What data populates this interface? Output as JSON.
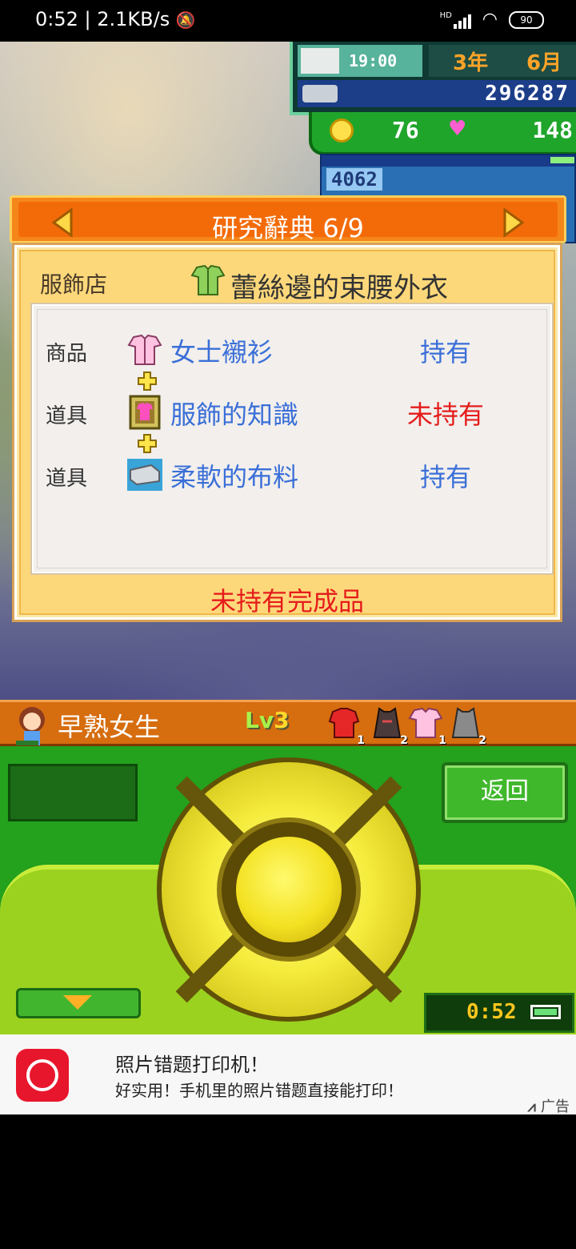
{
  "status_bar": {
    "time": "0:52",
    "net_speed": "2.1KB/s",
    "network_type": "HD",
    "battery": "90"
  },
  "hud": {
    "clock_time": "19:00",
    "year_label": "3年",
    "month_label": "6月",
    "money": "296287",
    "research_points": "76",
    "hearts": "148",
    "shop_customers": "4062"
  },
  "dictionary": {
    "title": "研究辭典 6/9",
    "shop_name": "服飾店",
    "product_name": "蕾絲邊的束腰外衣",
    "rows": [
      {
        "label": "商品",
        "name": "女士襯衫",
        "status": "持有"
      },
      {
        "label": "道具",
        "name": "服飾的知識",
        "status": "未持有"
      },
      {
        "label": "道具",
        "name": "柔軟的布料",
        "status": "持有"
      }
    ],
    "completion_status": "未持有完成品"
  },
  "character": {
    "name": "早熟女生",
    "level_prefix": "Lv",
    "level": "3",
    "equipment_counts": [
      "1",
      "2",
      "1",
      "2"
    ]
  },
  "console": {
    "back_label": "返回",
    "time": "0:52"
  },
  "ad": {
    "title": "照片错题打印机！",
    "description": "好实用！手机里的照片错题直接能打印！",
    "label": "广告"
  },
  "colors": {
    "have": "#3a6fd8",
    "not_have": "#e51c1c",
    "header_orange": "#f36b09",
    "console_green": "#24a11d"
  }
}
